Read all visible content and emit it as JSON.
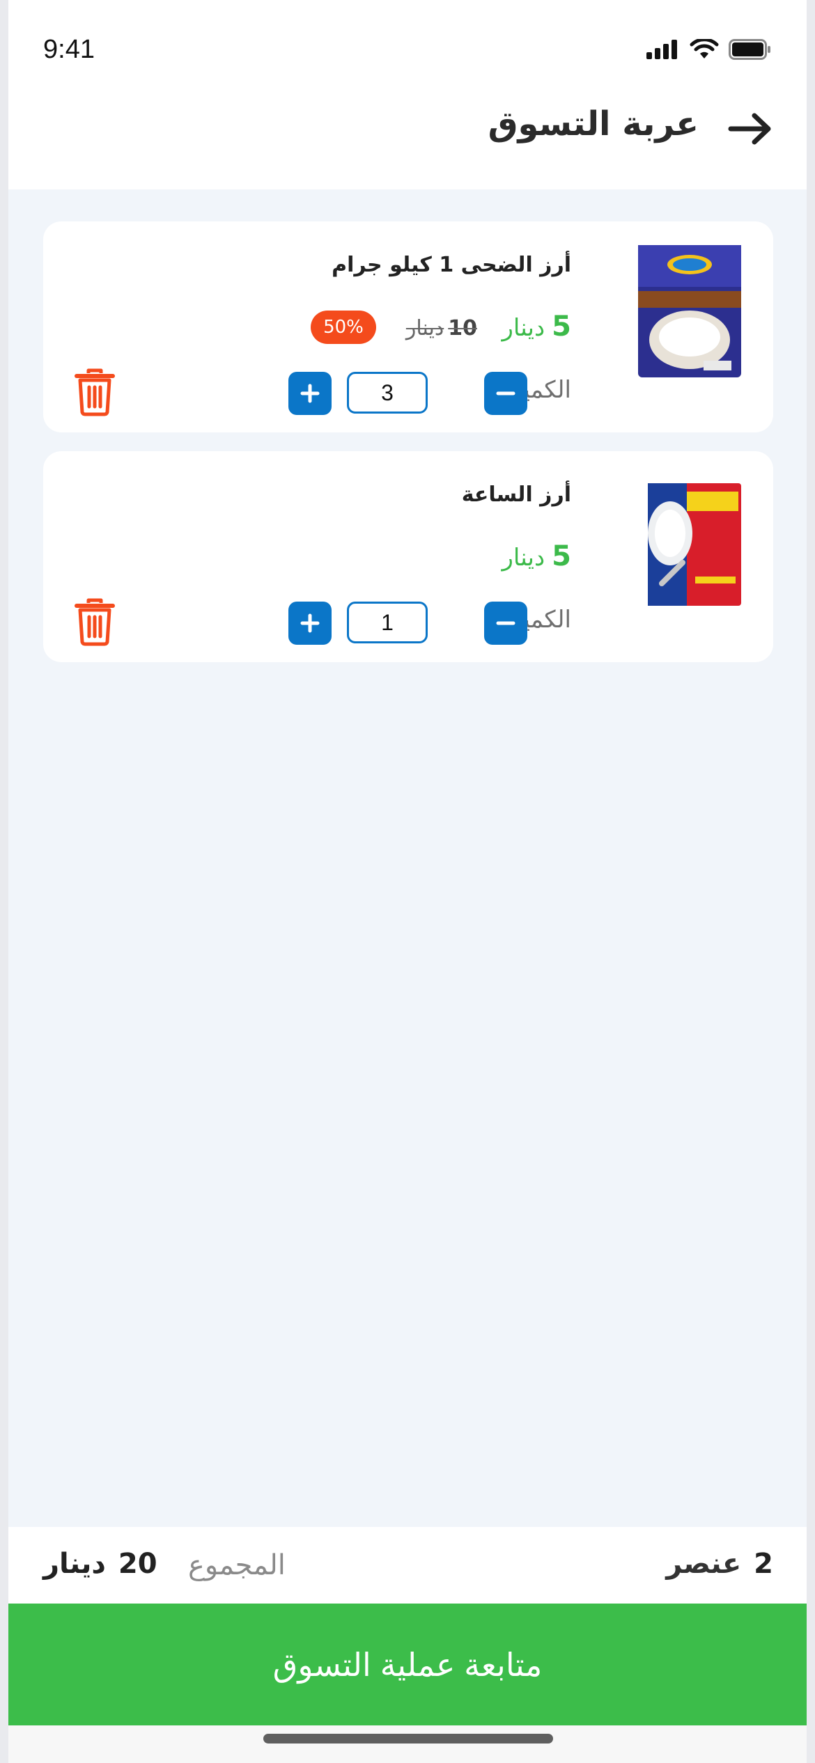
{
  "status_bar": {
    "time": "9:41"
  },
  "header": {
    "title": "عربة التسوق",
    "back_icon": "arrow-right-icon"
  },
  "cart_items": [
    {
      "name": "أرز الضحى 1 كيلو جرام",
      "price": "5",
      "currency": "دينار",
      "old_price": "10",
      "old_currency": "دينار",
      "discount": "50%",
      "quantity_label": "الكمية",
      "quantity": "3"
    },
    {
      "name": "أرز الساعة",
      "price": "5",
      "currency": "دينار",
      "quantity_label": "الكمية",
      "quantity": "1"
    }
  ],
  "summary": {
    "items_count": "2",
    "items_label": "عنصر",
    "total_label": "المجموع",
    "total_value": "20",
    "total_currency": "دينار"
  },
  "checkout_label": "متابعة عملية التسوق",
  "colors": {
    "accent_green": "#3cbd4a",
    "primary_blue": "#0b76c8",
    "danger_red": "#f44b1c"
  }
}
